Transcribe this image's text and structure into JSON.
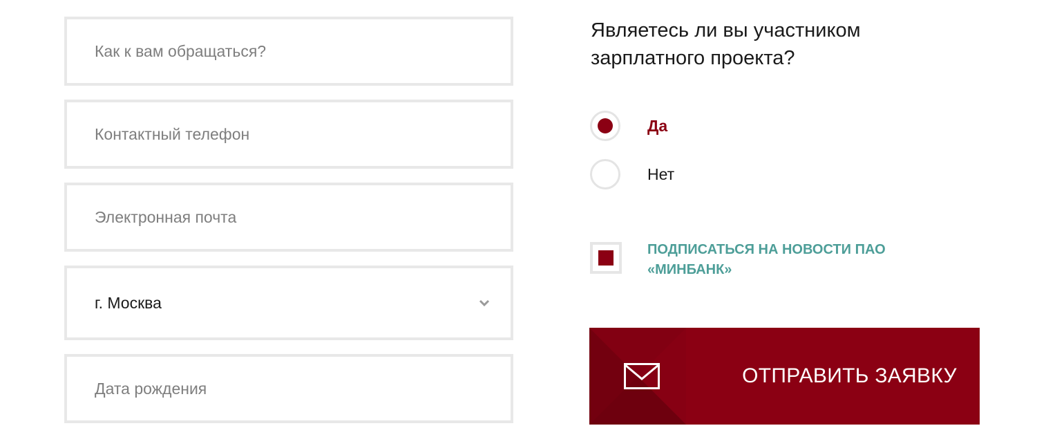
{
  "form": {
    "name_placeholder": "Как к вам обращаться?",
    "phone_placeholder": "Контактный телефон",
    "email_placeholder": "Электронная почта",
    "city_value": "г. Москва",
    "birthdate_placeholder": "Дата рождения"
  },
  "salary_project": {
    "question": "Являетесь ли вы участником зарплатного проекта?",
    "options": [
      {
        "label": "Да",
        "selected": true
      },
      {
        "label": "Нет",
        "selected": false
      }
    ]
  },
  "subscribe": {
    "label": "Подписаться на новости ПАО «Минбанк»",
    "checked": true
  },
  "submit": {
    "label": "ОТПРАВИТЬ ЗАЯВКУ",
    "icon": "envelope-icon"
  },
  "colors": {
    "accent": "#8b0013",
    "link_teal": "#4d9e98",
    "field_border": "#e8e8e8"
  }
}
